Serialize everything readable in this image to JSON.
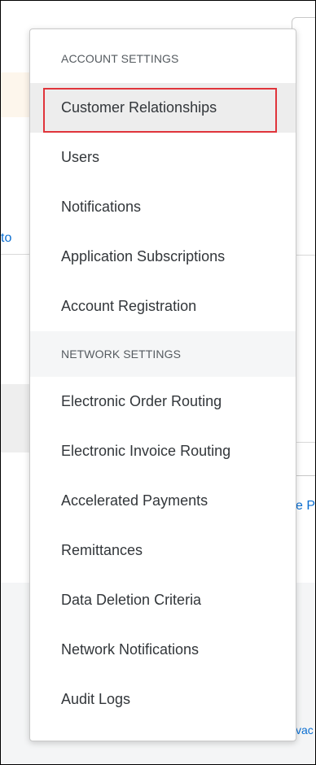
{
  "background": {
    "left_fragment_text": "to",
    "right_fragment_text": "e P",
    "bottom_right_fragment_text": "vac"
  },
  "menu": {
    "sections": [
      {
        "header": "ACCOUNT SETTINGS",
        "items": [
          {
            "label": "Customer Relationships",
            "selected": true
          },
          {
            "label": "Users"
          },
          {
            "label": "Notifications"
          },
          {
            "label": "Application Subscriptions"
          },
          {
            "label": "Account Registration"
          }
        ]
      },
      {
        "header": "NETWORK SETTINGS",
        "items": [
          {
            "label": "Electronic Order Routing"
          },
          {
            "label": "Electronic Invoice Routing"
          },
          {
            "label": "Accelerated Payments"
          },
          {
            "label": "Remittances"
          },
          {
            "label": "Data Deletion Criteria"
          },
          {
            "label": "Network Notifications"
          },
          {
            "label": "Audit Logs"
          }
        ]
      }
    ]
  },
  "colors": {
    "selection_outline": "#e0343b",
    "link": "#0a6ed1",
    "text": "#32363a"
  }
}
